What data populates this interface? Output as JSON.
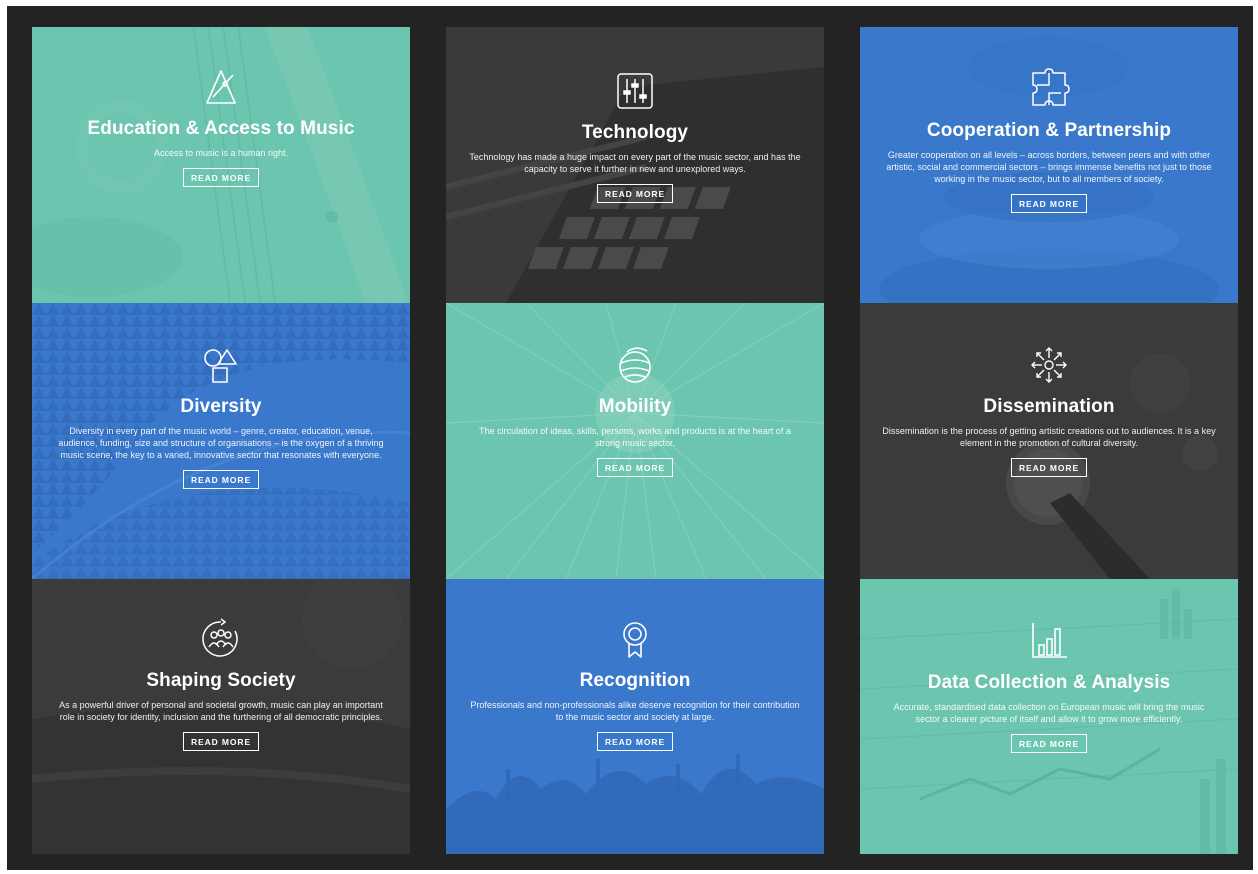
{
  "colors": {
    "teal": "#6cc5ae",
    "blue": "#3a78cc",
    "dark": "#3a3a3a",
    "frame": "#232323"
  },
  "columns": [
    {
      "tiles": [
        {
          "icon": "metronome-icon",
          "title": "Education & Access to Music",
          "description": "Access to music is a human right.",
          "button": "READ MORE"
        },
        {
          "icon": "shapes-icon",
          "title": "Diversity",
          "description": "Diversity in every part of the music world – genre, creator, education, venue, audience, funding, size and structure of organisations – is the oxygen of a thriving music scene, the key to a varied, innovative sector that resonates with everyone.",
          "button": "READ MORE"
        },
        {
          "icon": "community-icon",
          "title": "Shaping Society",
          "description": "As a powerful driver of personal and societal growth, music can play an important role in society for identity, inclusion and the furthering of all democratic principles.",
          "button": "READ MORE"
        }
      ]
    },
    {
      "tiles": [
        {
          "icon": "mixer-sliders-icon",
          "title": "Technology",
          "description": "Technology has made a huge impact on every part of the music sector, and has the capacity to serve it further in new and unexplored ways.",
          "button": "READ MORE"
        },
        {
          "icon": "globe-icon",
          "title": "Mobility",
          "description": "The circulation of ideas, skills, persons, works and products is at the heart of a strong music sector.",
          "button": "READ MORE"
        },
        {
          "icon": "award-ribbon-icon",
          "title": "Recognition",
          "description": "Professionals and non-professionals alike deserve recognition for their contribution to the music sector and society at large.",
          "button": "READ MORE"
        }
      ]
    },
    {
      "tiles": [
        {
          "icon": "puzzle-icon",
          "title": "Cooperation & Partnership",
          "description": "Greater cooperation on all levels – across borders, between peers and with other artistic, social and commercial sectors – brings immense benefits not just to those working in the music sector, but to all members of society.",
          "button": "READ MORE"
        },
        {
          "icon": "spread-arrows-icon",
          "title": "Dissemination",
          "description": "Dissemination is the process of getting artistic creations out to audiences. It is a key element in the promotion of cultural diversity.",
          "button": "READ MORE"
        },
        {
          "icon": "bar-chart-icon",
          "title": "Data Collection & Analysis",
          "description": "Accurate, standardised data collection on European music will bring the music sector a clearer picture of itself and allow it to grow more efficiently.",
          "button": "READ MORE"
        }
      ]
    }
  ]
}
